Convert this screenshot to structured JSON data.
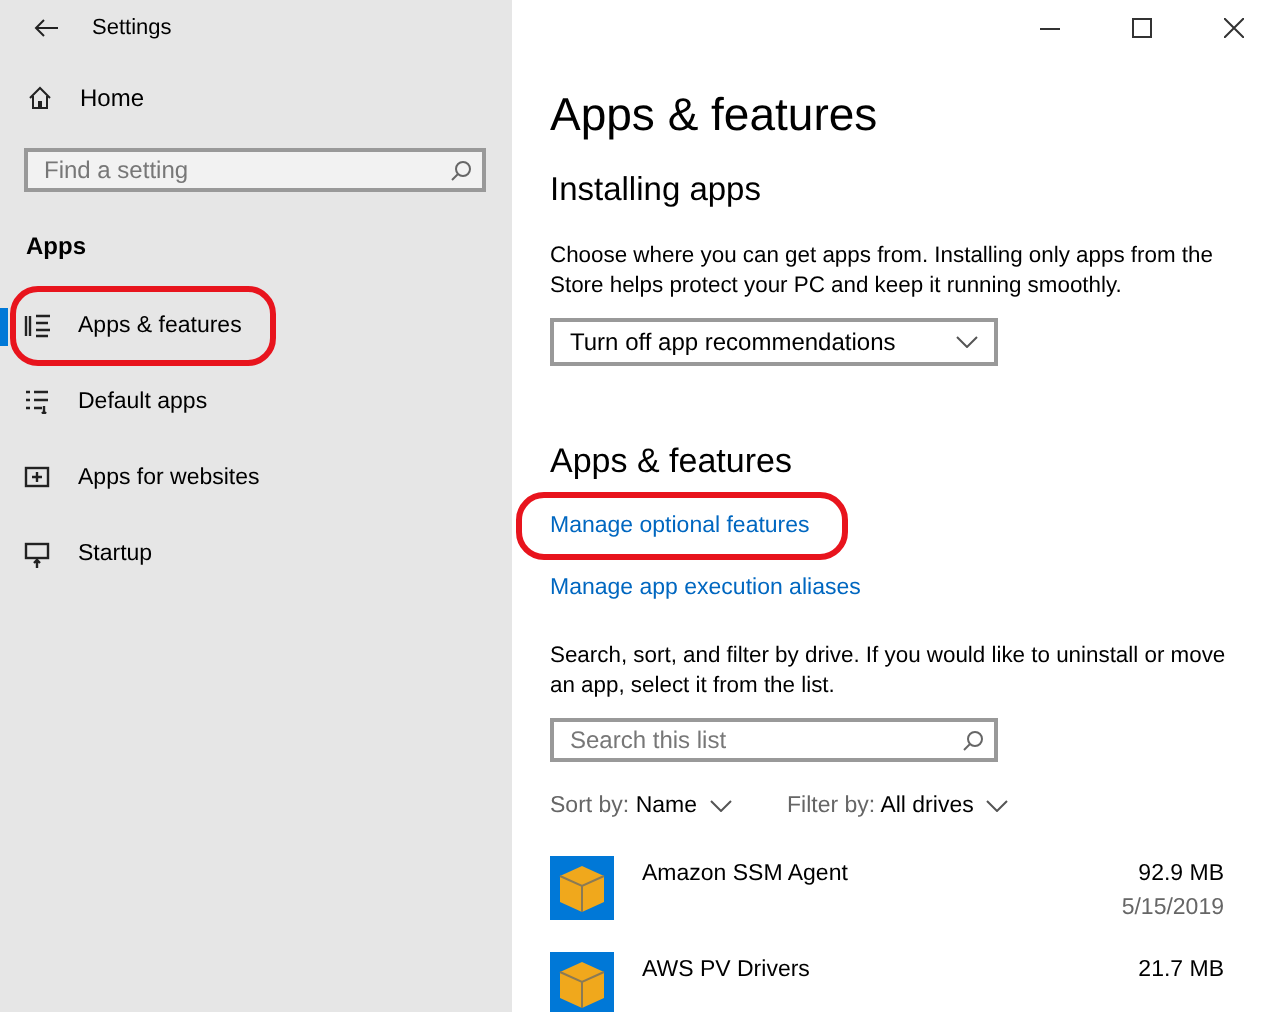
{
  "window": {
    "title": "Settings"
  },
  "sidebar": {
    "home": "Home",
    "search": {
      "placeholder": "Find a setting"
    },
    "section": "Apps",
    "items": [
      {
        "label": "Apps & features",
        "kind": "list",
        "selected": true,
        "annotated": true
      },
      {
        "label": "Default apps",
        "kind": "defaults",
        "selected": false,
        "annotated": false
      },
      {
        "label": "Apps for websites",
        "kind": "web",
        "selected": false,
        "annotated": false
      },
      {
        "label": "Startup",
        "kind": "startup",
        "selected": false,
        "annotated": false
      }
    ]
  },
  "main": {
    "title": "Apps & features",
    "installing": {
      "heading": "Installing apps",
      "text": "Choose where you can get apps from. Installing only apps from the Store helps protect your PC and keep it running smoothly.",
      "dropdown": "Turn off app recommendations"
    },
    "apps_features": {
      "heading": "Apps & features",
      "links": [
        {
          "label": "Manage optional features",
          "annotated": true
        },
        {
          "label": "Manage app execution aliases",
          "annotated": false
        }
      ],
      "text": "Search, sort, and filter by drive. If you would like to uninstall or move an app, select it from the list.",
      "search": {
        "placeholder": "Search this list"
      },
      "sort": {
        "label": "Sort by:",
        "value": "Name"
      },
      "filter": {
        "label": "Filter by:",
        "value": "All drives"
      },
      "apps": [
        {
          "name": "Amazon SSM Agent",
          "size": "92.9 MB",
          "date": "5/15/2019"
        },
        {
          "name": "AWS PV Drivers",
          "size": "21.7 MB"
        }
      ]
    }
  }
}
